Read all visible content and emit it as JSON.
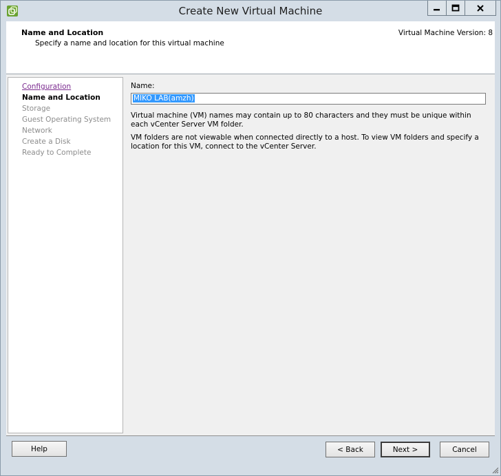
{
  "window": {
    "title": "Create New Virtual Machine",
    "min_glyph": "−",
    "max_glyph": "□",
    "close_glyph": "X"
  },
  "header": {
    "title": "Name and Location",
    "subtitle": "Specify a name and location for this virtual machine",
    "version": "Virtual Machine Version: 8"
  },
  "steps": [
    {
      "label": "Configuration",
      "state": "visited"
    },
    {
      "label": "Name and Location",
      "state": "current"
    },
    {
      "label": "Storage",
      "state": "pending"
    },
    {
      "label": "Guest Operating System",
      "state": "pending"
    },
    {
      "label": "Network",
      "state": "pending"
    },
    {
      "label": "Create a Disk",
      "state": "pending"
    },
    {
      "label": "Ready to Complete",
      "state": "pending"
    }
  ],
  "form": {
    "name_label": "Name:",
    "name_value": "MIKO LAB(amzh)",
    "help_text_1": "Virtual machine (VM) names may contain up to 80 characters and they must be unique within each vCenter Server VM folder.",
    "help_text_2": "VM folders are not viewable when connected directly to a host. To view VM folders and specify a location for this VM, connect to the vCenter Server."
  },
  "buttons": {
    "help": "Help",
    "back": "< Back",
    "next": "Next >",
    "cancel": "Cancel"
  },
  "colors": {
    "selection": "#3399ff",
    "visited_link": "#7b2a8f",
    "pending_step": "#8c8c8c",
    "app_icon_green": "#8dc63f"
  }
}
